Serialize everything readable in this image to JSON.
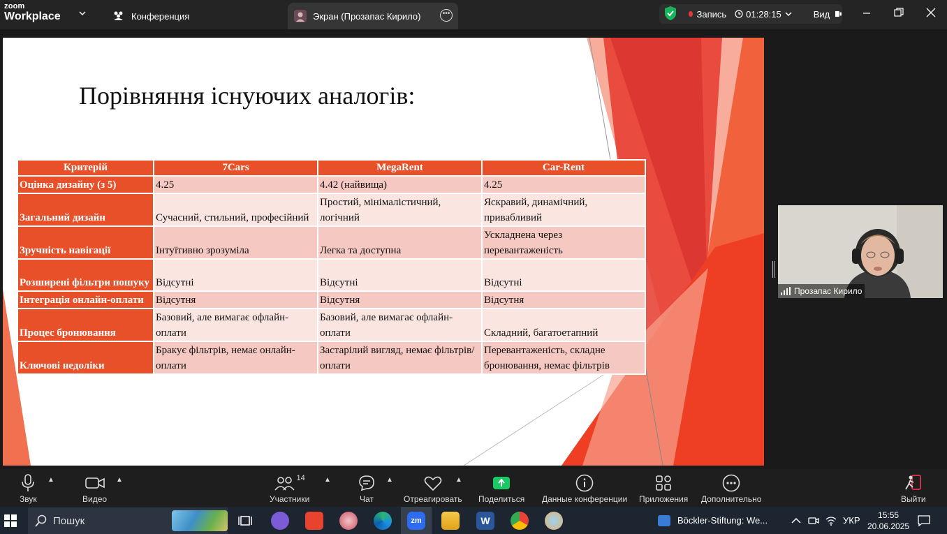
{
  "titlebar": {
    "logo_line1": "zoom",
    "logo_line2": "Workplace",
    "tab_conference": "Конференция",
    "tab_screen": "Экран (Прозапас Кирило)",
    "record_label": "Запись",
    "record_time": "01:28:15",
    "view_label": "Вид"
  },
  "slide": {
    "title": "Порівняння існуючих аналогів:",
    "table": {
      "headers": [
        "Критерій",
        "7Cars",
        "MegaRent",
        "Car-Rent"
      ],
      "rows": [
        {
          "criterion": "Оцінка дизайну (з 5)",
          "c1": "4.25",
          "c2": "4.42 (найвища)",
          "c3": "4.25"
        },
        {
          "criterion": "Загальний дизайн",
          "c1": "Сучасний, стильний, професійний",
          "c2": "Простий, мінімалістичний, логічний",
          "c3": "Яскравий, динамічний, привабливий"
        },
        {
          "criterion": "Зручність навігації",
          "c1": "Інтуїтивно зрозуміла",
          "c2": "Легка та доступна",
          "c3": "Ускладнена через перевантаженість"
        },
        {
          "criterion": "Розширені фільтри пошуку",
          "c1": "Відсутні",
          "c2": "Відсутні",
          "c3": "Відсутні"
        },
        {
          "criterion": "Інтеграція онлайн-оплати",
          "c1": "Відсутня",
          "c2": "Відсутня",
          "c3": "Відсутня"
        },
        {
          "criterion": "Процес бронювання",
          "c1": "Базовий, але вимагає офлайн-оплати",
          "c2": "Базовий, але вимагає офлайн-оплати",
          "c3": "Складний, багатоетапний"
        },
        {
          "criterion": "Ключові недоліки",
          "c1": "Бракує фільтрів, немає онлайн-оплати",
          "c2": "Застарілий вигляд, немає фільтрів/оплати",
          "c3": "Перевантаженість, складне бронювання, немає фільтрів"
        }
      ]
    }
  },
  "video": {
    "participant_name": "Прозапас Кирило"
  },
  "toolbar": {
    "audio": "Звук",
    "video": "Видео",
    "participants": "Участники",
    "participants_count": "14",
    "chat": "Чат",
    "react": "Отреагировать",
    "share": "Поделиться",
    "meeting_info": "Данные конференции",
    "apps": "Приложения",
    "more": "Дополнительно",
    "leave": "Выйти"
  },
  "taskbar": {
    "search_placeholder": "Пошук",
    "news_widget": "Böckler-Stiftung: We...",
    "language": "УКР",
    "time": "15:55",
    "date": "20.06.2025"
  },
  "colors": {
    "accent_orange": "#e8502a",
    "share_green": "#18c964",
    "record_red": "#e03a3a"
  }
}
